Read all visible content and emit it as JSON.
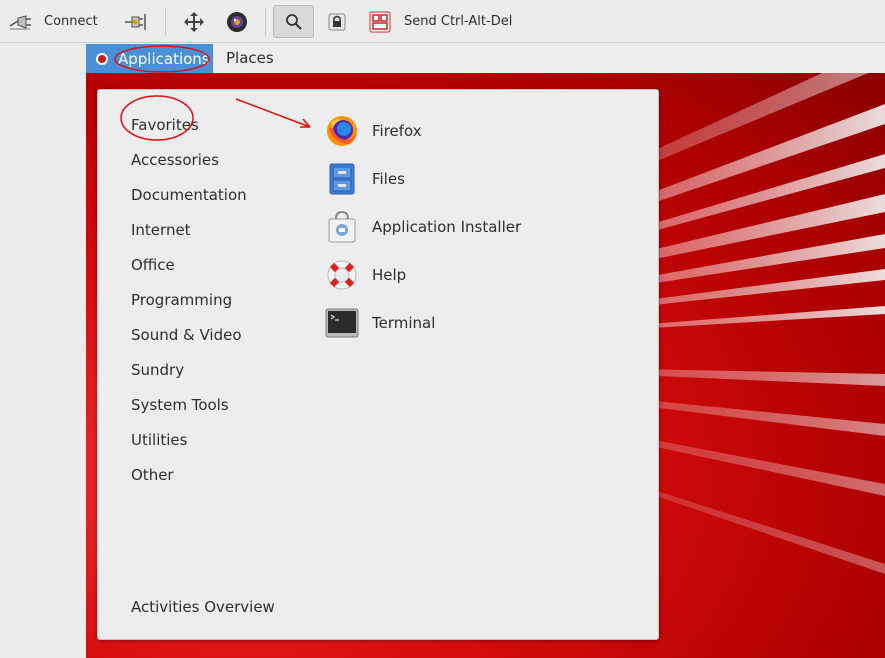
{
  "toolbar": {
    "connect_label": "Connect",
    "send_cad_label": "Send Ctrl-Alt-Del",
    "icons": [
      "disconnect-plug-icon",
      "connect-plug-icon",
      "move-icon",
      "screenshot-camera-icon",
      "search-icon",
      "lock-icon",
      "keyboard-icon"
    ]
  },
  "topbar": {
    "applications_label": "Applications",
    "places_label": "Places"
  },
  "menu": {
    "categories": [
      "Favorites",
      "Accessories",
      "Documentation",
      "Internet",
      "Office",
      "Programming",
      "Sound & Video",
      "Sundry",
      "System Tools",
      "Utilities",
      "Other"
    ],
    "apps": [
      "Firefox",
      "Files",
      "Application Installer",
      "Help",
      "Terminal"
    ],
    "activities_label": "Activities Overview"
  },
  "colors": {
    "highlight": "#4a90d9",
    "desktop_red": "#d40a0a",
    "annotation_red": "#e01010"
  }
}
